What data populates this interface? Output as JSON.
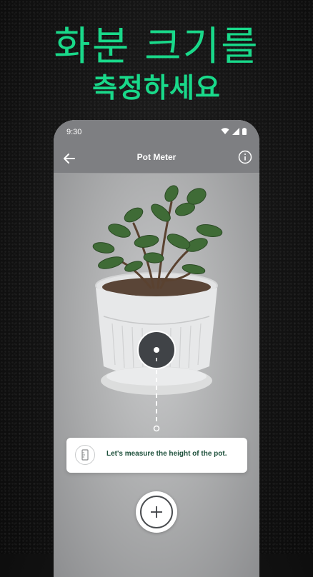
{
  "promo": {
    "headline_line1": "화분 크기를",
    "headline_line2": "측정하세요"
  },
  "status_bar": {
    "time": "9:30",
    "icons": [
      "wifi-icon",
      "signal-icon",
      "battery-icon"
    ]
  },
  "app_bar": {
    "title": "Pot Meter",
    "back_icon": "arrow-left-icon",
    "info_icon": "info-icon"
  },
  "hint": {
    "icon": "ruler-icon",
    "text": "Let's measure the height of the pot."
  },
  "actions": {
    "add_icon": "plus-icon"
  },
  "colors": {
    "accent": "#19d98a",
    "hint_text": "#1c4f3a",
    "app_bar": "#7e7f82"
  }
}
